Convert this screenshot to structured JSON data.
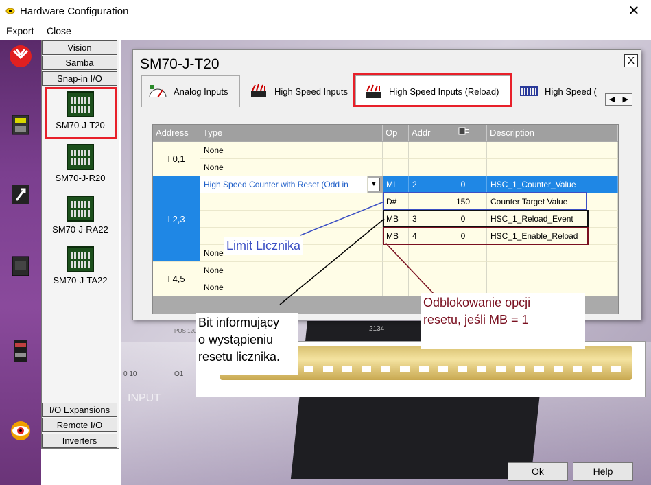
{
  "window": {
    "title": "Hardware Configuration",
    "close_glyph": "✕"
  },
  "menu": {
    "items": [
      "Export",
      "Close"
    ]
  },
  "palette": {
    "top_buttons": [
      "Vision",
      "Samba",
      "Snap-in I/O"
    ],
    "modules": [
      "SM70-J-T20",
      "SM70-J-R20",
      "SM70-J-RA22",
      "SM70-J-TA22"
    ],
    "bottom_buttons": [
      "I/O Expansions",
      "Remote I/O",
      "Inverters"
    ]
  },
  "dialog": {
    "title": "SM70-J-T20",
    "close_glyph": "X",
    "tabs": [
      "Analog Inputs",
      "High Speed Inputs",
      "High Speed Inputs (Reload)",
      "High Speed ("
    ],
    "nav": [
      "◀",
      "▶"
    ]
  },
  "grid": {
    "headers": {
      "address": "Address",
      "type": "Type",
      "op": "Op",
      "addr": "Addr",
      "description": "Description"
    },
    "groups": [
      {
        "address": "I 0,1",
        "rows": [
          {
            "type": "None",
            "op": "",
            "addr": "",
            "value": "",
            "desc": ""
          },
          {
            "type": "None",
            "op": "",
            "addr": "",
            "value": "",
            "desc": ""
          }
        ]
      },
      {
        "address": "I 2,3",
        "rows": [
          {
            "type": "High Speed Counter with Reset (Odd in",
            "op": "MI",
            "addr": "2",
            "value": "0",
            "desc": "HSC_1_Counter_Value"
          },
          {
            "type": "",
            "op": "D#",
            "addr": "",
            "value": "150",
            "desc": "Counter Target Value"
          },
          {
            "type": "",
            "op": "MB",
            "addr": "3",
            "value": "0",
            "desc": "HSC_1_Reload_Event"
          },
          {
            "type": "",
            "op": "MB",
            "addr": "4",
            "value": "0",
            "desc": "HSC_1_Enable_Reload"
          },
          {
            "type": "None",
            "op": "",
            "addr": "",
            "value": "",
            "desc": ""
          }
        ]
      },
      {
        "address": "I 4,5",
        "rows": [
          {
            "type": "None",
            "op": "",
            "addr": "",
            "value": "",
            "desc": ""
          },
          {
            "type": "None",
            "op": "",
            "addr": "",
            "value": "",
            "desc": ""
          }
        ]
      }
    ]
  },
  "annotations": {
    "limit": "Limit Licznika",
    "reset_bit": [
      "Bit informujący",
      "o wystąpieniu",
      "resetu licznika."
    ],
    "unlock": [
      "Odblokowanie opcji",
      "resetu, jeśli MB = 1"
    ]
  },
  "background": {
    "input_label": "INPUT",
    "misc": [
      "0 10",
      "O1",
      "2134",
      "POS 120"
    ]
  },
  "buttons": {
    "ok": "Ok",
    "help": "Help"
  },
  "colors": {
    "highlight_red": "#e8202a",
    "selection_blue": "#1f87e5",
    "annotation_blue": "#3b4fc4",
    "annotation_maroon": "#7a1020"
  }
}
